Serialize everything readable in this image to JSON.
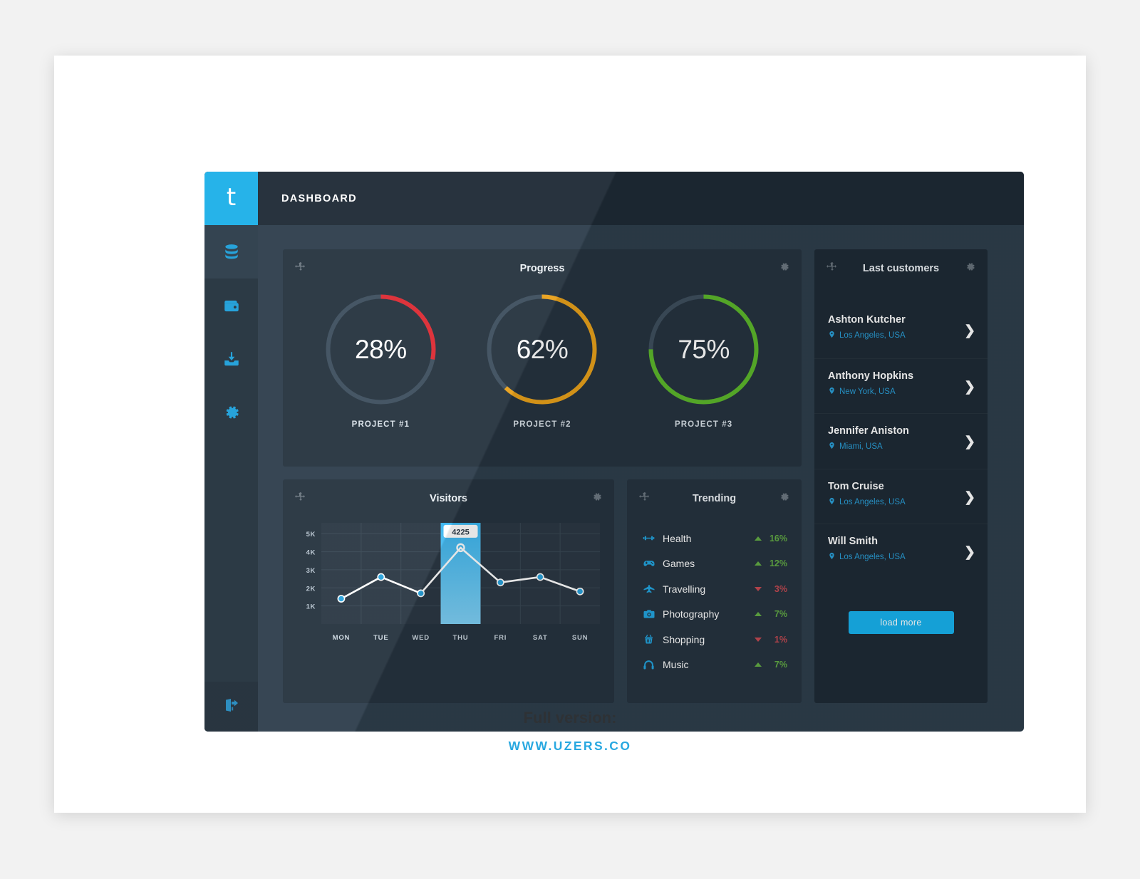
{
  "brand": {
    "logo_glyph": "t",
    "accent": "#1cb0e8"
  },
  "topbar": {
    "title": "DASHBOARD"
  },
  "sidebar": {
    "items": [
      {
        "name": "database",
        "icon": "database-icon",
        "active": true
      },
      {
        "name": "wallet",
        "icon": "wallet-icon",
        "active": false
      },
      {
        "name": "inbox-download",
        "icon": "inbox-download-icon",
        "active": false
      },
      {
        "name": "settings",
        "icon": "gear-icon",
        "active": false
      }
    ],
    "bottom": {
      "name": "logout",
      "icon": "logout-icon"
    }
  },
  "progress_panel": {
    "title": "Progress",
    "move_icon": "move-handle-icon",
    "gear_icon": "gear-icon",
    "projects": [
      {
        "caption": "PROJECT #1",
        "percent": 28,
        "label": "28%",
        "color": "#dc2b33"
      },
      {
        "caption": "PROJECT #2",
        "percent": 62,
        "label": "62%",
        "color": "#e9a11b"
      },
      {
        "caption": "PROJECT #3",
        "percent": 75,
        "label": "75%",
        "color": "#5cb82b"
      }
    ],
    "track_color": "#3e4f5e"
  },
  "visitors_panel": {
    "title": "Visitors",
    "move_icon": "move-handle-icon",
    "gear_icon": "gear-icon"
  },
  "chart_data": {
    "type": "line",
    "title": "Visitors",
    "categories": [
      "MON",
      "TUE",
      "WED",
      "THU",
      "FRI",
      "SAT",
      "SUN"
    ],
    "values": [
      1400,
      2600,
      1700,
      4225,
      2300,
      2600,
      1800
    ],
    "ytick_labels": [
      "5K",
      "4K",
      "3K",
      "2K",
      "1K"
    ],
    "ytick_values": [
      5000,
      4000,
      3000,
      2000,
      1000
    ],
    "ylim": [
      0,
      5600
    ],
    "xlabel": "",
    "ylabel": "",
    "grid": true,
    "highlight_index": 3,
    "highlight_label": "4225",
    "line_color": "#ffffff",
    "point_color": "#2aa3dd",
    "highlight_color": "#39b5ef"
  },
  "trending_panel": {
    "title": "Trending",
    "move_icon": "move-handle-icon",
    "gear_icon": "gear-icon",
    "items": [
      {
        "label": "Health",
        "icon": "dumbbell-icon",
        "delta": "16%",
        "direction": "up"
      },
      {
        "label": "Games",
        "icon": "gamepad-icon",
        "delta": "12%",
        "direction": "up"
      },
      {
        "label": "Travelling",
        "icon": "plane-icon",
        "delta": "3%",
        "direction": "down"
      },
      {
        "label": "Photography",
        "icon": "camera-icon",
        "delta": "7%",
        "direction": "up"
      },
      {
        "label": "Shopping",
        "icon": "basket-icon",
        "delta": "1%",
        "direction": "down"
      },
      {
        "label": "Music",
        "icon": "headphones-icon",
        "delta": "7%",
        "direction": "up"
      }
    ],
    "up_color": "#63ad45",
    "down_color": "#c44a52"
  },
  "customers_panel": {
    "title": "Last customers",
    "move_icon": "move-handle-icon",
    "gear_icon": "gear-icon",
    "load_more_label": "load more",
    "items": [
      {
        "name": "Ashton Kutcher",
        "location": "Los Angeles, USA",
        "pin_icon": "map-pin-icon",
        "chevron": "chevron-right-icon"
      },
      {
        "name": "Anthony Hopkins",
        "location": "New York, USA",
        "pin_icon": "map-pin-icon",
        "chevron": "chevron-right-icon"
      },
      {
        "name": "Jennifer Aniston",
        "location": "Miami, USA",
        "pin_icon": "map-pin-icon",
        "chevron": "chevron-right-icon"
      },
      {
        "name": "Tom Cruise",
        "location": "Los Angeles, USA",
        "pin_icon": "map-pin-icon",
        "chevron": "chevron-right-icon"
      },
      {
        "name": "Will Smith",
        "location": "Los Angeles, USA",
        "pin_icon": "map-pin-icon",
        "chevron": "chevron-right-icon"
      }
    ]
  },
  "footer": {
    "title": "Full version:",
    "link": "WWW.UZERS.CO"
  }
}
